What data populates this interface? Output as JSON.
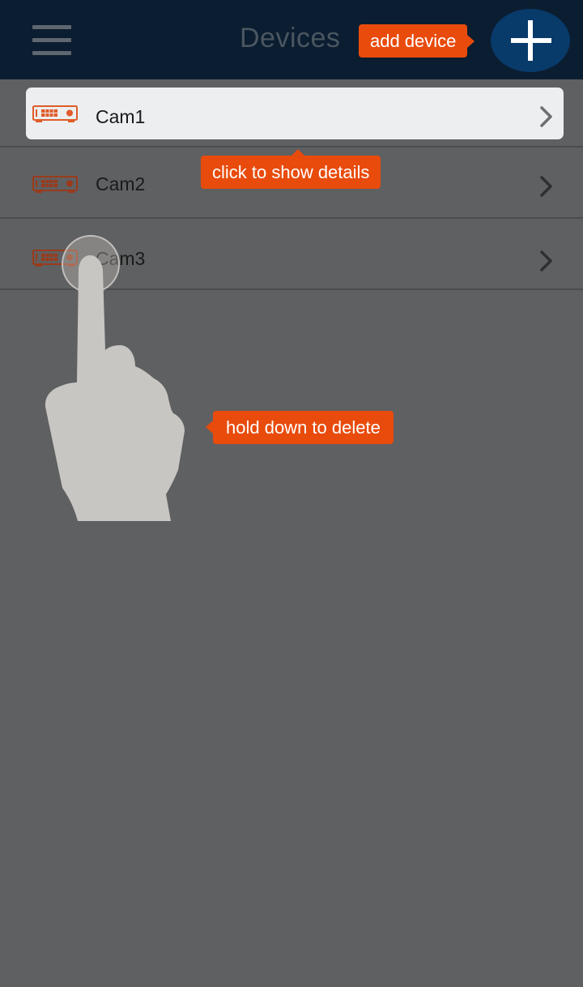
{
  "header": {
    "title": "Devices",
    "menu_icon": "hamburger-menu-icon",
    "add_icon": "plus-icon"
  },
  "devices": [
    {
      "name": "Cam1",
      "icon": "dvr-recorder-icon",
      "highlighted": true
    },
    {
      "name": "Cam2",
      "icon": "dvr-recorder-icon",
      "highlighted": false
    },
    {
      "name": "Cam3",
      "icon": "dvr-recorder-icon",
      "highlighted": false
    }
  ],
  "tooltips": {
    "add": "add device",
    "details": "click to show details",
    "delete": "hold down to delete"
  },
  "gesture": {
    "icon": "pointing-hand-icon",
    "touch_indicator": "touch-ring"
  },
  "colors": {
    "header_bg": "#0b1d30",
    "screen_bg": "#5f6062",
    "accent": "#e84b0c",
    "add_button": "#083a6a",
    "highlight_row": "#eceef0",
    "device_icon_active": "#e05b28",
    "device_icon": "#9a3a1a"
  }
}
